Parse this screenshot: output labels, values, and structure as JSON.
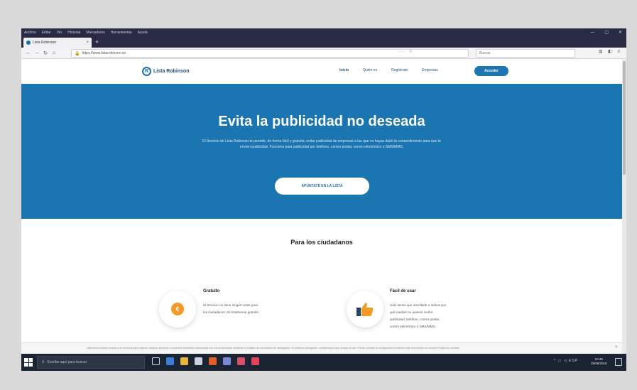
{
  "browser": {
    "menu": [
      "Archivo",
      "Editar",
      "Ver",
      "Historial",
      "Marcadores",
      "Herramientas",
      "Ayuda"
    ],
    "window_controls": [
      "—",
      "▢",
      "✕"
    ],
    "tab": {
      "title": "Lista Robinson",
      "close": "×"
    },
    "new_tab": "+",
    "url": "https://www.listarobinson.es",
    "search_placeholder": "Buscar"
  },
  "site": {
    "brand": "Lista Robinson",
    "logo_letter": "R",
    "nav": [
      "Inicio",
      "Quién es",
      "Regístrate",
      "Empresas"
    ],
    "access_button": "Acceder"
  },
  "hero": {
    "title": "Evita la publicidad no deseada",
    "description": "El Servicio de Lista Robinson te permite, de forma fácil y gratuita, evitar publicidad de empresas a las que no hayas dado tu consentimiento para que te envíen publicidad. Funciona para publicidad por teléfono, correo postal, correo electrónico o SMS/MMS.",
    "cta": "APÚNTATE EN LA LISTA"
  },
  "citizens": {
    "title": "Para los ciudadanos",
    "features": [
      {
        "title": "Gratuito",
        "icon": "coin-icon",
        "icon_glyph": "€",
        "text": [
          "El Servicio no tiene ningún coste para",
          "los ciudadanos. Es totalmente gratuito."
        ]
      },
      {
        "title": "Fácil de usar",
        "icon": "thumbs-up-icon",
        "text": [
          "Sólo tienes que inscribirte e indicar por",
          "qué medios no quieres recibir",
          "publicidad: teléfono, correo postal,",
          "correo electrónico o SMS/MMS."
        ]
      }
    ]
  },
  "cookie_notice": {
    "text": "Utilizamos cookies propias y de terceros para mejorar nuestros servicios y mostrarle publicidad relacionada con sus preferencias mediante el análisis de sus hábitos de navegación. Si continúa navegando, consideramos que acepta su uso. Puede cambiar la configuración u obtener más información en nuestra Política de cookies.",
    "close": "×"
  },
  "taskbar": {
    "search_placeholder": "Escribe aquí para buscar",
    "time": "10:45",
    "date": "25/06/2018"
  },
  "colors": {
    "hero_blue": "#1a75b0",
    "browser_dark": "#2b2a45",
    "accent_orange": "#f39a24",
    "taskbar": "#1b2432"
  }
}
